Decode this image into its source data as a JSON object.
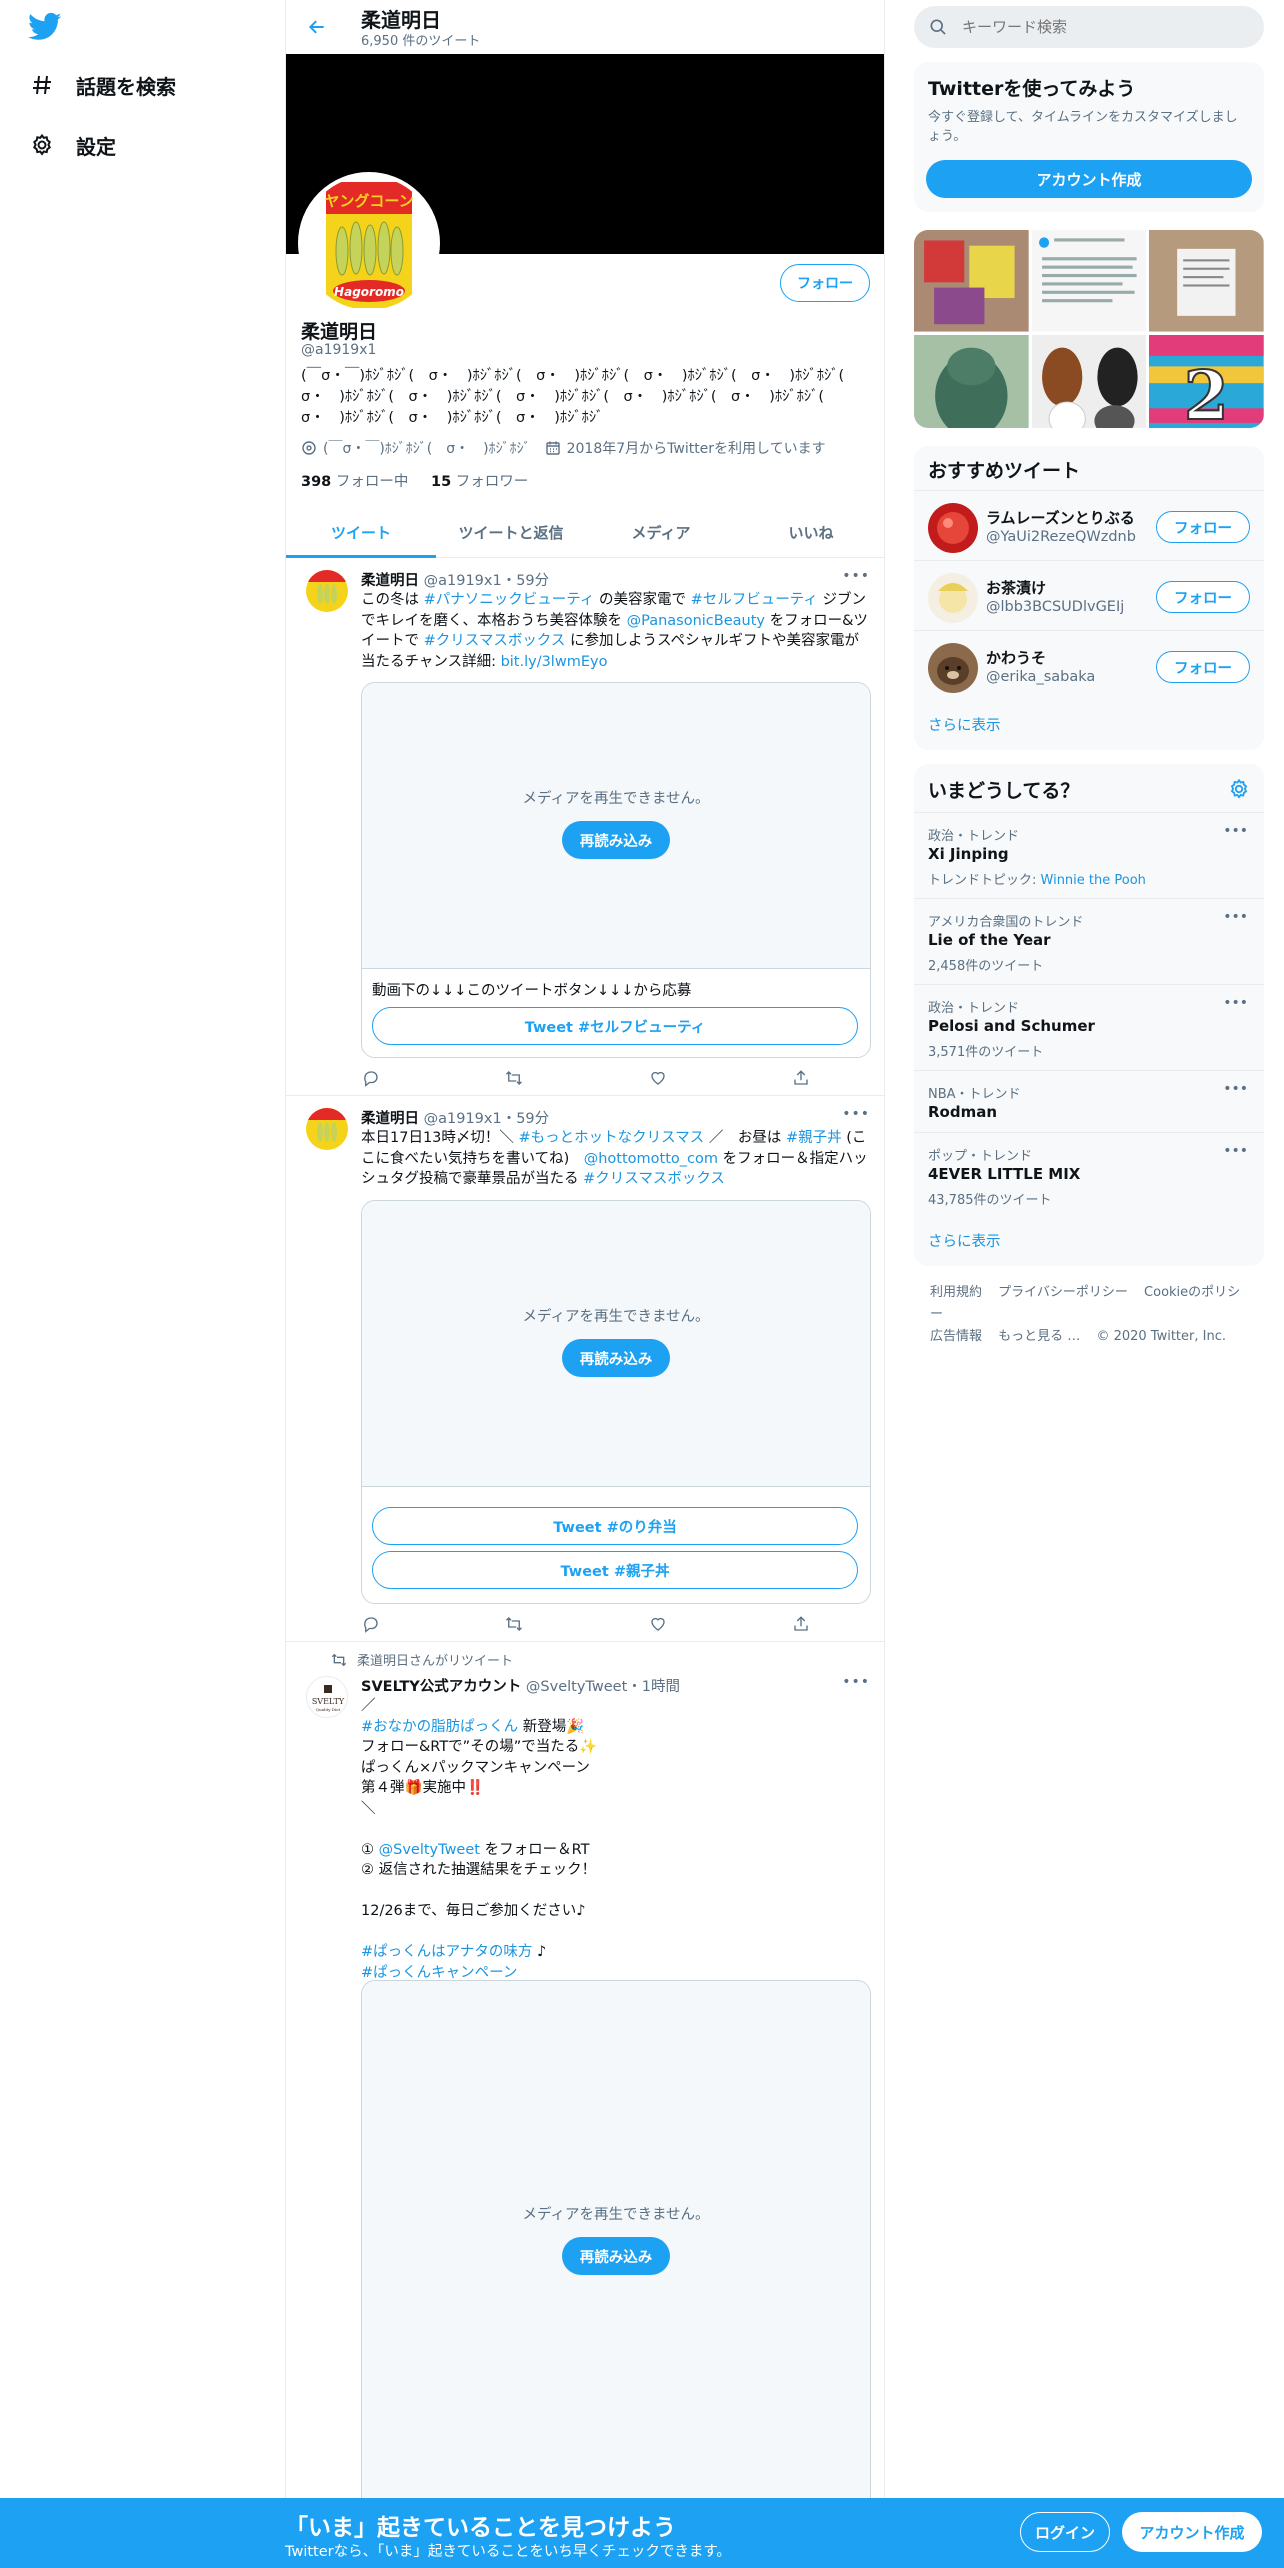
{
  "nav": {
    "logo_icon": "twitter-bird-icon",
    "items": [
      {
        "label": "話題を検索",
        "icon": "hashtag-icon"
      },
      {
        "label": "設定",
        "icon": "gear-icon"
      }
    ]
  },
  "header": {
    "name": "柔道明日",
    "tweet_count": "6,950 件のツイート"
  },
  "profile": {
    "name": "柔道明日",
    "handle": "@a1919x1",
    "follow_label": "フォロー",
    "bio": "(￣σ・￣)ﾎｼﾞﾎｼﾞ(　σ・　)ﾎｼﾞﾎｼﾞ(　σ・　)ﾎｼﾞﾎｼﾞ(　σ・　)ﾎｼﾞﾎｼﾞ(　σ・　)ﾎｼﾞﾎｼﾞ(　σ・　)ﾎｼﾞﾎｼﾞ(　σ・　)ﾎｼﾞﾎｼﾞ(　σ・　)ﾎｼﾞﾎｼﾞ(　σ・　)ﾎｼﾞﾎｼﾞ(　σ・　)ﾎｼﾞﾎｼﾞ(　σ・　)ﾎｼﾞﾎｼﾞ(　σ・　)ﾎｼﾞﾎｼﾞ(　σ・　)ﾎｼﾞﾎｼﾞ",
    "location": "(￣σ・￣)ﾎｼﾞﾎｼﾞ(　σ・　)ﾎｼﾞﾎｼﾞ",
    "joined": "2018年7月からTwitterを利用しています",
    "following_count": "398",
    "following_label": "フォロー中",
    "followers_count": "15",
    "followers_label": "フォロワー"
  },
  "tabs": [
    "ツイート",
    "ツイートと返信",
    "メディア",
    "いいね"
  ],
  "tweets": [
    {
      "name": "柔道明日",
      "meta": "@a1919x1・59分",
      "body_parts": [
        "この冬は ",
        "#パナソニックビューティ",
        " の美容家電で ",
        "#セルフビューティ",
        " ジブンでキレイを磨く、本格おうち美容体験を ",
        "@PanasonicBeauty",
        " をフォロー&ツイートで ",
        "#クリスマスボックス",
        " に参加しようスペシャルギフトや美容家電が当たるチャンス詳細: ",
        "bit.ly/3lwmEyo"
      ],
      "media_msg": "メディアを再生できません。",
      "reload": "再読み込み",
      "card_caption": "動画下の↓↓↓このツイートボタン↓↓↓から応募",
      "buttons": [
        "Tweet #セルフビューティ"
      ]
    },
    {
      "name": "柔道明日",
      "meta": "@a1919x1・59分",
      "body_parts": [
        "本日17日13時〆切！＼ ",
        "#もっとホットなクリスマス",
        " ／　お昼は ",
        "#親子丼",
        " (ここに食べたい気持ちを書いてね)　",
        "@hottomotto_com",
        " をフォロー＆指定ハッシュタグ投稿で豪華景品が当たる ",
        "#クリスマスボックス"
      ],
      "media_msg": "メディアを再生できません。",
      "reload": "再読み込み",
      "buttons": [
        "Tweet #のり弁当",
        "Tweet #親子丼"
      ]
    },
    {
      "retweeted_by": "柔道明日さんがリツイート",
      "name": "SVELTY公式アカウント",
      "meta": "@SveltyTweet・1時間",
      "lines": [
        {
          "t": "／"
        },
        {
          "h": "#おなかの脂肪ぱっくん",
          "t": " 新登場🎉"
        },
        {
          "t": "フォロー&RTで”その場”で当たる✨"
        },
        {
          "t": "ぱっくん×パックマンキャンペーン"
        },
        {
          "t": "第４弾🎁実施中‼️"
        },
        {
          "t": "＼"
        },
        {
          "t": ""
        },
        {
          "p": "① ",
          "h": "@SveltyTweet",
          "t": " をフォロー＆RT"
        },
        {
          "t": "② 返信された抽選結果をチェック！"
        },
        {
          "t": ""
        },
        {
          "t": "12/26まで、毎日ご参加ください♪"
        },
        {
          "t": ""
        },
        {
          "h": "#ぱっくんはアナタの味方",
          "t": " ♪"
        },
        {
          "h": "#ぱっくんキャンペーン",
          "t": ""
        }
      ],
      "media_msg": "メディアを再生できません。",
      "reload": "再読み込み"
    }
  ],
  "search": {
    "placeholder": "キーワード検索"
  },
  "signup_panel": {
    "title": "Twitterを使ってみよう",
    "desc": "今すぐ登録して、タイムラインをカスタマイズしましょう。",
    "button": "アカウント作成"
  },
  "recommended": {
    "title": "おすすめツイート",
    "users": [
      {
        "name": "ラムレーズンとりぶる",
        "handle": "@YaUi2RezeQWzdnb",
        "button": "フォロー"
      },
      {
        "name": "お茶漬け",
        "handle": "@lbb3BCSUDlvGEIj",
        "button": "フォロー"
      },
      {
        "name": "かわうそ",
        "handle": "@erika_sabaka",
        "button": "フォロー"
      }
    ],
    "more": "さらに表示"
  },
  "trends": {
    "title": "いまどうしてる？",
    "items": [
      {
        "category": "政治・トレンド",
        "name": "Xi Jinping",
        "sub_label": "トレンドトピック: ",
        "sub_link": "Winnie the Pooh"
      },
      {
        "category": "アメリカ合衆国のトレンド",
        "name": "Lie of the Year",
        "sub": "2,458件のツイート"
      },
      {
        "category": "政治・トレンド",
        "name": "Pelosi and Schumer",
        "sub": "3,571件のツイート"
      },
      {
        "category": "NBA・トレンド",
        "name": "Rodman"
      },
      {
        "category": "ポップ・トレンド",
        "name": "4EVER LITTLE MIX",
        "sub": "43,785件のツイート"
      }
    ],
    "more": "さらに表示"
  },
  "footer": {
    "line1": [
      "利用規約",
      "プライバシーポリシー",
      "Cookieのポリシー"
    ],
    "line2": [
      "広告情報",
      "もっと見る …",
      "© 2020 Twitter, Inc."
    ]
  },
  "bottombar": {
    "title": "「いま」起きていることを見つけよう",
    "sub": "Twitterなら、「いま」起きていることをいち早くチェックできます。",
    "login": "ログイン",
    "signup": "アカウント作成"
  },
  "colors": {
    "accent": "#1da1f2",
    "link": "#1b95e0",
    "muted": "#5b7083",
    "border": "#e6ecf0"
  }
}
